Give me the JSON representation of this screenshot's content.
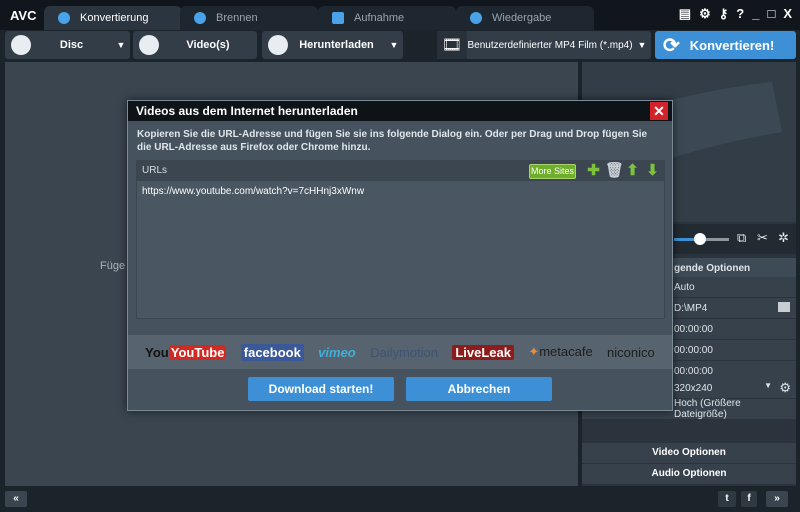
{
  "app": {
    "logo": "AVC"
  },
  "tabs": [
    {
      "label": "Konvertierung",
      "active": true
    },
    {
      "label": "Brennen"
    },
    {
      "label": "Aufnahme"
    },
    {
      "label": "Wiedergabe"
    }
  ],
  "window_icons": {
    "help": "?",
    "minimize": "_",
    "maximize": "□",
    "close": "X"
  },
  "toolbar": {
    "disc": "Disc",
    "videos": "Video(s)",
    "download": "Herunterladen",
    "format": "Benutzerdefinierter MP4 Film (*.mp4)",
    "convert": "Konvertieren!"
  },
  "main": {
    "hint": "Füge"
  },
  "right_panel": {
    "header": "gende Optionen",
    "rows": [
      "Auto",
      "D:\\MP4",
      "00:00:00",
      "00:00:00",
      "00:00:00",
      "320x240",
      "Hoch (Größere Dateigröße)"
    ],
    "video_options": "Video Optionen",
    "audio_options": "Audio Optionen",
    "slider_value": 0.45
  },
  "bottom": {
    "left": "«",
    "right": "»"
  },
  "dialog": {
    "title": "Videos aus dem Internet herunterladen",
    "close": "✕",
    "description": "Kopieren Sie die URL-Adresse und fügen Sie sie ins folgende Dialog ein. Oder per Drag und Drop fügen Sie die URL-Adresse aus Firefox oder Chrome hinzu.",
    "urls_label": "URLs",
    "more_sites": "More Sites",
    "url": "https://www.youtube.com/watch?v=7cHHnj3xWnw",
    "sites": [
      "YouTube",
      "facebook",
      "vimeo",
      "Dailymotion",
      "LiveLeak",
      "metacafe",
      "niconico"
    ],
    "start": "Download starten!",
    "cancel": "Abbrechen"
  },
  "colors": {
    "accent": "#3e90d6",
    "close": "#d2232a",
    "green": "#6fae2b"
  }
}
